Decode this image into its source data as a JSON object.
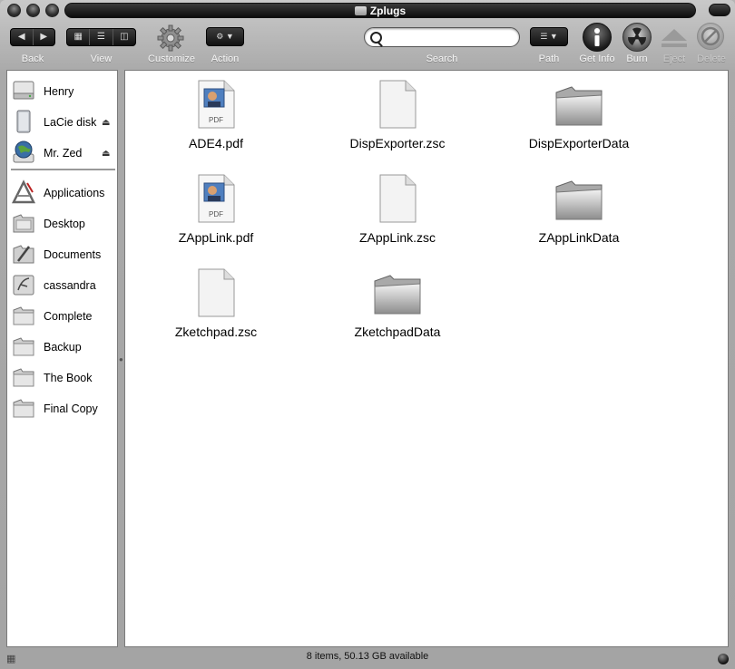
{
  "window": {
    "title": "Zplugs"
  },
  "toolbar": {
    "back_label": "Back",
    "view_label": "View",
    "customize_label": "Customize",
    "action_label": "Action",
    "search_label": "Search",
    "search_value": "",
    "path_label": "Path",
    "get_info_label": "Get Info",
    "burn_label": "Burn",
    "eject_label": "Eject",
    "delete_label": "Delete"
  },
  "sidebar": {
    "devices": [
      {
        "label": "Henry",
        "icon": "hard-drive-icon",
        "ejectable": false
      },
      {
        "label": "LaCie disk",
        "icon": "external-drive-icon",
        "ejectable": true
      },
      {
        "label": "Mr. Zed",
        "icon": "network-globe-icon",
        "ejectable": true
      }
    ],
    "places": [
      {
        "label": "Applications",
        "icon": "applications-icon"
      },
      {
        "label": "Desktop",
        "icon": "desktop-icon"
      },
      {
        "label": "Documents",
        "icon": "documents-icon"
      },
      {
        "label": "cassandra",
        "icon": "home-icon"
      },
      {
        "label": "Complete",
        "icon": "folder-icon"
      },
      {
        "label": "Backup",
        "icon": "folder-icon"
      },
      {
        "label": "The Book",
        "icon": "folder-icon"
      },
      {
        "label": "Final Copy",
        "icon": "folder-icon"
      }
    ]
  },
  "files": [
    {
      "name": "ADE4.pdf",
      "kind": "pdf",
      "icon_badge": "PDF"
    },
    {
      "name": "DispExporter.zsc",
      "kind": "document"
    },
    {
      "name": "DispExporterData",
      "kind": "folder"
    },
    {
      "name": "ZAppLink.pdf",
      "kind": "pdf",
      "icon_badge": "PDF"
    },
    {
      "name": "ZAppLink.zsc",
      "kind": "document"
    },
    {
      "name": "ZAppLinkData",
      "kind": "folder"
    },
    {
      "name": "Zketchpad.zsc",
      "kind": "document"
    },
    {
      "name": "ZketchpadData",
      "kind": "folder"
    }
  ],
  "status": {
    "text": "8 items, 50.13 GB available"
  }
}
